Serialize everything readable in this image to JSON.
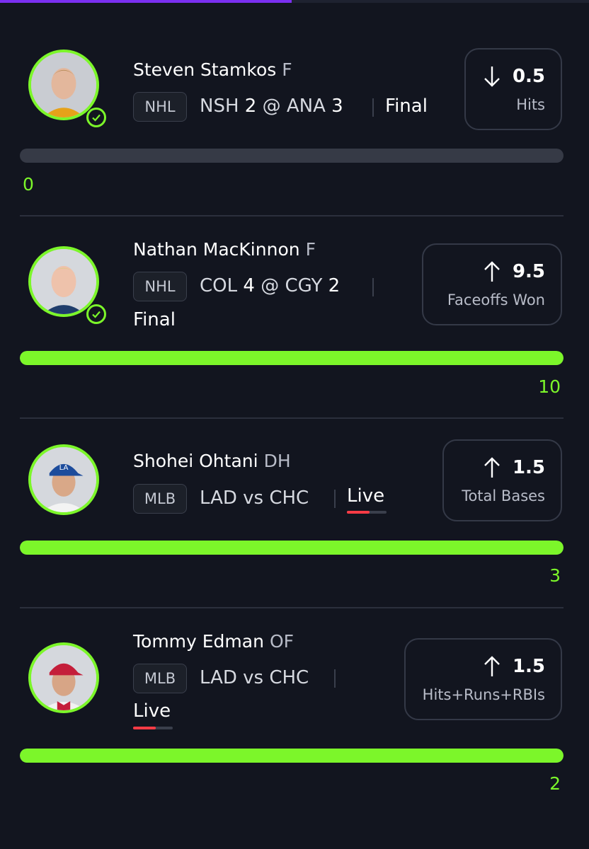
{
  "header": {
    "progress": 0.49
  },
  "colors": {
    "accent": "#7cf62a",
    "background": "#12151f",
    "live": "#ff3b45",
    "header_bar": "#7a2ff0"
  },
  "cards": [
    {
      "player": "Steven Stamkos",
      "position": "F",
      "league": "NHL",
      "game": {
        "away": "NSH",
        "away_score": "2",
        "at": "@",
        "home": "ANA",
        "home_score": "3"
      },
      "status": "Final",
      "checked": true,
      "prop": {
        "direction": "down",
        "direction_icon": "arrow-down-icon",
        "line": "0.5",
        "stat": "Hits"
      },
      "result": "0",
      "progress": 0.0
    },
    {
      "player": "Nathan MacKinnon",
      "position": "F",
      "league": "NHL",
      "game": {
        "away": "COL",
        "away_score": "4",
        "at": "@",
        "home": "CGY",
        "home_score": "2"
      },
      "status": "Final",
      "checked": true,
      "prop": {
        "direction": "up",
        "direction_icon": "arrow-up-icon",
        "line": "9.5",
        "stat": "Faceoffs Won"
      },
      "result": "10",
      "progress": 1.0
    },
    {
      "player": "Shohei Ohtani",
      "position": "DH",
      "league": "MLB",
      "game": {
        "teams": "LAD vs CHC"
      },
      "status": "Live",
      "checked": false,
      "prop": {
        "direction": "up",
        "direction_icon": "arrow-up-icon",
        "line": "1.5",
        "stat": "Total Bases"
      },
      "result": "3",
      "progress": 1.0
    },
    {
      "player": "Tommy Edman",
      "position": "OF",
      "league": "MLB",
      "game": {
        "teams": "LAD vs CHC"
      },
      "status": "Live",
      "checked": false,
      "prop": {
        "direction": "up",
        "direction_icon": "arrow-up-icon",
        "line": "1.5",
        "stat": "Hits+Runs+RBIs"
      },
      "result": "2",
      "progress": 1.0
    }
  ]
}
